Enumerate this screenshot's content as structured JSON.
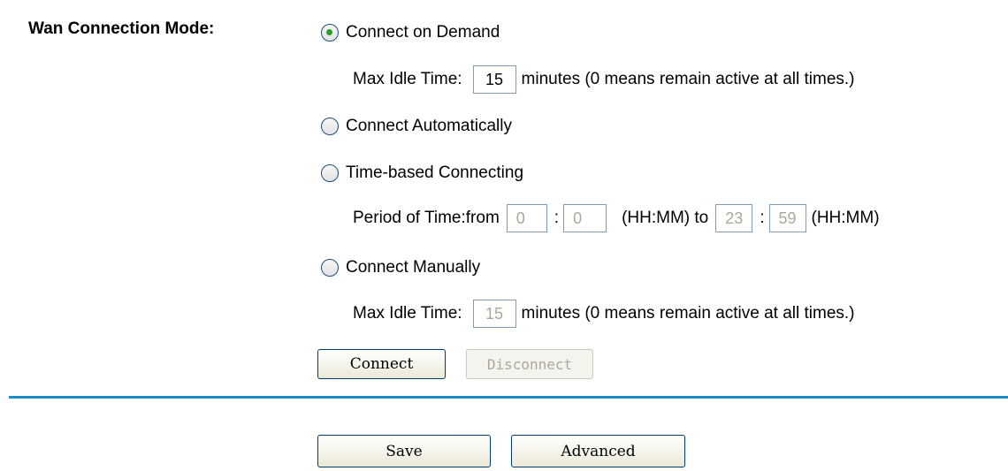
{
  "wan": {
    "label": "Wan Connection Mode:",
    "options": [
      {
        "label": "Connect on Demand",
        "checked": true
      },
      {
        "label": "Connect Automatically",
        "checked": false
      },
      {
        "label": "Time-based Connecting",
        "checked": false
      },
      {
        "label": "Connect Manually",
        "checked": false
      }
    ],
    "demand": {
      "idle_label": "Max Idle Time:",
      "idle_value": "15",
      "idle_suffix": "minutes (0 means remain active at all times.)"
    },
    "time": {
      "label": "Period of Time:from",
      "from_h": "0",
      "sep1": ":",
      "from_m": "0",
      "to_label": "(HH:MM) to",
      "to_h": "23",
      "sep2": ":",
      "to_m": "59",
      "suffix": "(HH:MM)"
    },
    "manual": {
      "idle_label": "Max Idle Time:",
      "idle_value": "15",
      "idle_suffix": "minutes (0 means remain active at all times.)"
    }
  },
  "buttons": {
    "connect": "Connect",
    "disconnect": "Disconnect",
    "save": "Save",
    "advanced": "Advanced"
  },
  "colors": {
    "divider": "#1c8dc4",
    "radio_checked": "#21a121"
  }
}
